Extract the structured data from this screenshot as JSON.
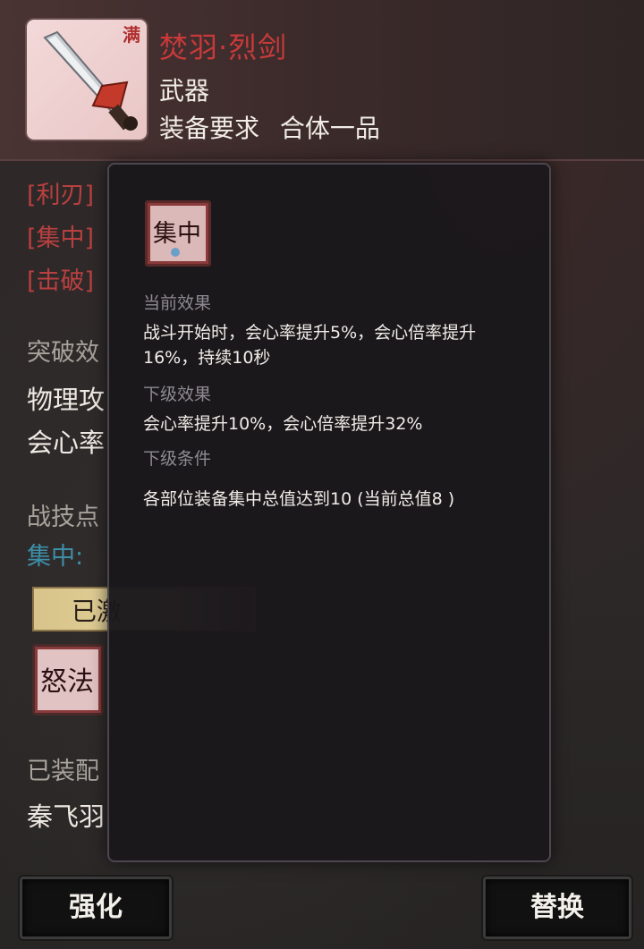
{
  "item": {
    "badge": "满",
    "name": "焚羽·烈剑",
    "type": "武器",
    "requirement_label": "装备要求",
    "requirement_value": "合体一品"
  },
  "attributes": [
    "[利刃]",
    "[集中]",
    "[击破]"
  ],
  "breakthrough": {
    "title": "突破效",
    "lines": [
      "物理攻",
      "会心率"
    ]
  },
  "battle_skill": {
    "title": "战技点",
    "focus_line": "集中:",
    "activated_label": "已激",
    "skill_icon_text": "怒法"
  },
  "equipped": {
    "title": "已装配",
    "character": "秦飞羽"
  },
  "popup": {
    "icon_text": "集中",
    "current_label": "当前效果",
    "current_text": "战斗开始时，会心率提升5%，会心倍率提升16%，持续10秒",
    "next_label": "下级效果",
    "next_text": "会心率提升10%，会心倍率提升32%",
    "condition_label": "下级条件",
    "condition_text": "各部位装备集中总值达到10 (当前总值8 )"
  },
  "buttons": {
    "enhance": "强化",
    "replace": "替换"
  },
  "colors": {
    "item_name": "#c83a3a",
    "attribute": "#b84040",
    "focus": "#3d8fa8",
    "popup_bg": "#1b181c"
  }
}
